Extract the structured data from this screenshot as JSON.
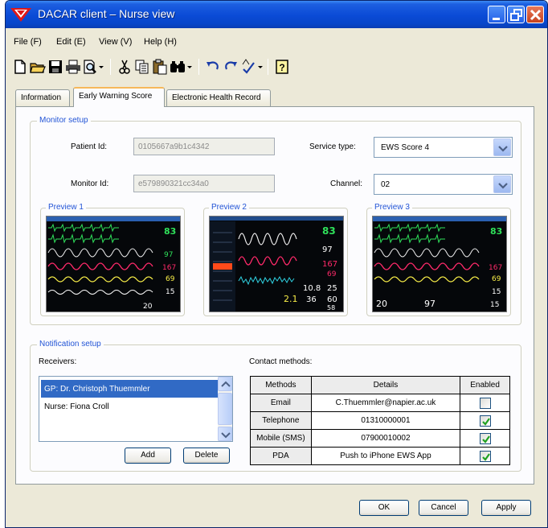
{
  "window": {
    "title": "DACAR client – Nurse view"
  },
  "menu": [
    {
      "label": "File (F)"
    },
    {
      "label": "Edit (E)"
    },
    {
      "label": "View (V)"
    },
    {
      "label": "Help (H)"
    }
  ],
  "toolbar_icons": [
    "new-file-icon",
    "open-folder-icon",
    "save-icon",
    "print-icon",
    "print-preview-icon",
    "cut-icon",
    "copy-icon",
    "paste-icon",
    "find-icon",
    "undo-icon",
    "redo-icon",
    "spellcheck-icon",
    "help-icon"
  ],
  "tabs": [
    {
      "label": "Information",
      "active": false
    },
    {
      "label": "Early Warning Score",
      "active": true
    },
    {
      "label": "Electronic Health Record",
      "active": false
    }
  ],
  "monitor_setup": {
    "title": "Monitor setup",
    "patient_id_label": "Patient Id:",
    "patient_id": "0105667a9b1c4342",
    "monitor_id_label": "Monitor Id:",
    "monitor_id": "e579890321cc34a0",
    "service_type_label": "Service type:",
    "service_type": "EWS Score 4",
    "channel_label": "Channel:",
    "channel": "02",
    "previews": [
      {
        "title": "Preview 1"
      },
      {
        "title": "Preview 2"
      },
      {
        "title": "Preview 3"
      }
    ]
  },
  "notification_setup": {
    "title": "Notification setup",
    "receivers_label": "Receivers:",
    "receivers": [
      {
        "name": "GP: Dr. Christoph Thuemmler",
        "selected": true
      },
      {
        "name": "Nurse: Fiona Croll",
        "selected": false
      }
    ],
    "add_label": "Add",
    "delete_label": "Delete",
    "contact_methods_label": "Contact methods:",
    "table_headers": [
      "Methods",
      "Details",
      "Enabled"
    ],
    "rows": [
      {
        "method": "Email",
        "details": "C.Thuemmler@napier.ac.uk",
        "enabled": false
      },
      {
        "method": "Telephone",
        "details": "01310000001",
        "enabled": true
      },
      {
        "method": "Mobile (SMS)",
        "details": "07900010002",
        "enabled": true
      },
      {
        "method": "PDA",
        "details": "Push to iPhone EWS App",
        "enabled": true
      }
    ]
  },
  "footer": {
    "ok_label": "OK",
    "cancel_label": "Cancel",
    "apply_label": "Apply"
  },
  "colors": {
    "titlebar": "#0a4ad6",
    "selection": "#316ac5",
    "group_title": "#2254d6",
    "active_tab_accent": "#f6b85a"
  }
}
